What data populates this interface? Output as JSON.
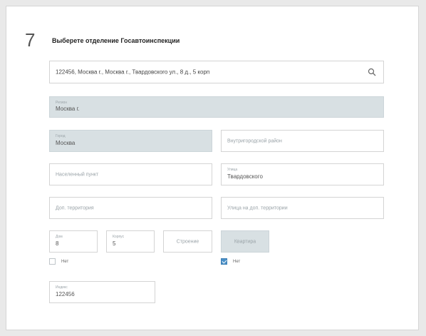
{
  "step": {
    "number": "7",
    "title": "Выберете отделение Госавтоинспекции"
  },
  "search": {
    "value": "122456, Москва г., Москва г., Твардовского ул., 8 д., 5 корп"
  },
  "region": {
    "label": "Регион",
    "value": "Москва г."
  },
  "city": {
    "label": "Город",
    "value": "Москва"
  },
  "district": {
    "placeholder": "Внутригородской район"
  },
  "locality": {
    "placeholder": "Населенный пункт"
  },
  "street": {
    "label": "Улица",
    "value": "Твардовского"
  },
  "add_territory": {
    "placeholder": "Доп. территория"
  },
  "street_add_territory": {
    "placeholder": "Улица на доп. территории"
  },
  "house": {
    "label": "Дом",
    "value": "8"
  },
  "korpus": {
    "label": "Корпус",
    "value": "5"
  },
  "stroenie": {
    "placeholder": "Строение"
  },
  "apartment": {
    "placeholder": "Квартира"
  },
  "house_none": {
    "label": "Нет",
    "checked": false
  },
  "apartment_none": {
    "label": "Нет",
    "checked": true
  },
  "index": {
    "label": "Индекс",
    "value": "122456"
  },
  "colors": {
    "accent": "#4a90c8",
    "disabled_bg": "#d8e0e3"
  }
}
